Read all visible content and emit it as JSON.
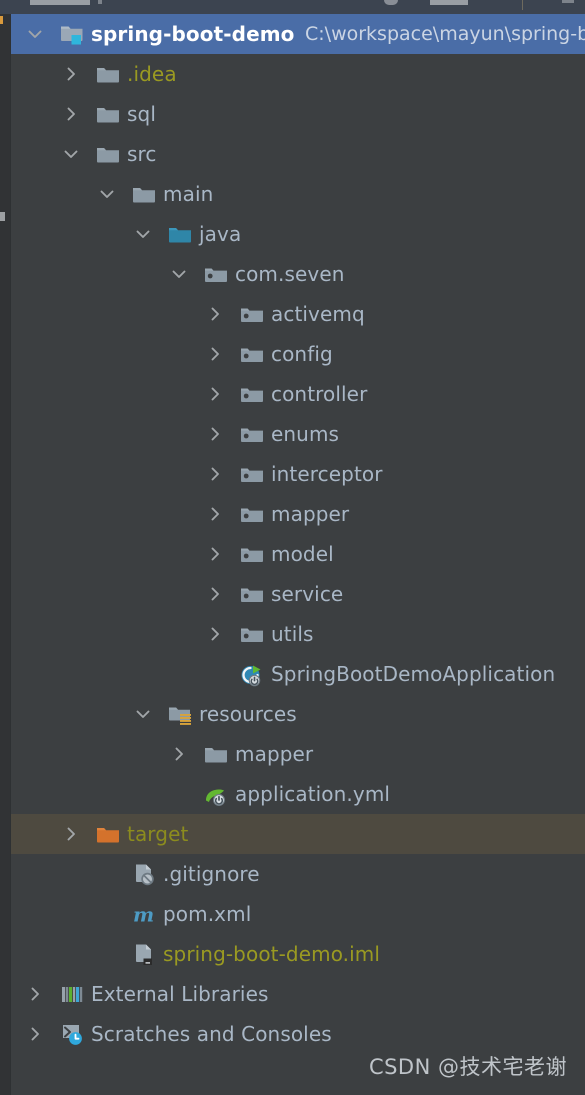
{
  "theme": {
    "background": "#3C3F41",
    "selection_background": "#4A6DA7",
    "hover_background": "#4E4A40",
    "text_default": "#A9B7C6",
    "text_excluded": "#9A9A22",
    "toolbar_background": "#3C4450",
    "gutter_background": "#313335"
  },
  "project_tree": {
    "rows": [
      {
        "label": "spring-boot-demo",
        "secondary": "C:\\workspace\\mayun\\spring-boot-",
        "icon": "module-icon",
        "arrow": "chevron-down-icon",
        "depth": 0,
        "state": "selected",
        "color": "#FFFFFF"
      },
      {
        "label": ".idea",
        "secondary": "",
        "icon": "folder-icon",
        "arrow": "chevron-right-icon",
        "depth": 1,
        "state": "normal",
        "color": "#9A9A22"
      },
      {
        "label": "sql",
        "secondary": "",
        "icon": "folder-icon",
        "arrow": "chevron-right-icon",
        "depth": 1,
        "state": "normal",
        "color": "#A9B7C6"
      },
      {
        "label": "src",
        "secondary": "",
        "icon": "folder-icon",
        "arrow": "chevron-down-icon",
        "depth": 1,
        "state": "normal",
        "color": "#A9B7C6"
      },
      {
        "label": "main",
        "secondary": "",
        "icon": "folder-icon",
        "arrow": "chevron-down-icon",
        "depth": 2,
        "state": "normal",
        "color": "#A9B7C6"
      },
      {
        "label": "java",
        "secondary": "",
        "icon": "source-root-folder-icon",
        "arrow": "chevron-down-icon",
        "depth": 3,
        "state": "normal",
        "color": "#A9B7C6"
      },
      {
        "label": "com.seven",
        "secondary": "",
        "icon": "package-icon",
        "arrow": "chevron-down-icon",
        "depth": 4,
        "state": "normal",
        "color": "#A9B7C6"
      },
      {
        "label": "activemq",
        "secondary": "",
        "icon": "package-icon",
        "arrow": "chevron-right-icon",
        "depth": 5,
        "state": "normal",
        "color": "#A9B7C6"
      },
      {
        "label": "config",
        "secondary": "",
        "icon": "package-icon",
        "arrow": "chevron-right-icon",
        "depth": 5,
        "state": "normal",
        "color": "#A9B7C6"
      },
      {
        "label": "controller",
        "secondary": "",
        "icon": "package-icon",
        "arrow": "chevron-right-icon",
        "depth": 5,
        "state": "normal",
        "color": "#A9B7C6"
      },
      {
        "label": "enums",
        "secondary": "",
        "icon": "package-icon",
        "arrow": "chevron-right-icon",
        "depth": 5,
        "state": "normal",
        "color": "#A9B7C6"
      },
      {
        "label": "interceptor",
        "secondary": "",
        "icon": "package-icon",
        "arrow": "chevron-right-icon",
        "depth": 5,
        "state": "normal",
        "color": "#A9B7C6"
      },
      {
        "label": "mapper",
        "secondary": "",
        "icon": "package-icon",
        "arrow": "chevron-right-icon",
        "depth": 5,
        "state": "normal",
        "color": "#A9B7C6"
      },
      {
        "label": "model",
        "secondary": "",
        "icon": "package-icon",
        "arrow": "chevron-right-icon",
        "depth": 5,
        "state": "normal",
        "color": "#A9B7C6"
      },
      {
        "label": "service",
        "secondary": "",
        "icon": "package-icon",
        "arrow": "chevron-right-icon",
        "depth": 5,
        "state": "normal",
        "color": "#A9B7C6"
      },
      {
        "label": "utils",
        "secondary": "",
        "icon": "package-icon",
        "arrow": "chevron-right-icon",
        "depth": 5,
        "state": "normal",
        "color": "#A9B7C6"
      },
      {
        "label": "SpringBootDemoApplication",
        "secondary": "",
        "icon": "spring-boot-class-icon",
        "arrow": "",
        "depth": 5,
        "state": "normal",
        "color": "#A9B7C6"
      },
      {
        "label": "resources",
        "secondary": "",
        "icon": "resource-root-folder-icon",
        "arrow": "chevron-down-icon",
        "depth": 3,
        "state": "normal",
        "color": "#A9B7C6"
      },
      {
        "label": "mapper",
        "secondary": "",
        "icon": "folder-icon",
        "arrow": "chevron-right-icon",
        "depth": 4,
        "state": "normal",
        "color": "#A9B7C6"
      },
      {
        "label": "application.yml",
        "secondary": "",
        "icon": "spring-yaml-icon",
        "arrow": "",
        "depth": 4,
        "state": "normal",
        "color": "#A9B7C6"
      },
      {
        "label": "target",
        "secondary": "",
        "icon": "excluded-folder-icon",
        "arrow": "chevron-right-icon",
        "depth": 1,
        "state": "hovered",
        "color": "#8C8C1E"
      },
      {
        "label": ".gitignore",
        "secondary": "",
        "icon": "gitignore-file-icon",
        "arrow": "",
        "depth": 2,
        "state": "normal",
        "color": "#A9B7C6"
      },
      {
        "label": "pom.xml",
        "secondary": "",
        "icon": "maven-pom-icon",
        "arrow": "",
        "depth": 2,
        "state": "normal",
        "color": "#A9B7C6"
      },
      {
        "label": "spring-boot-demo.iml",
        "secondary": "",
        "icon": "iml-module-file-icon",
        "arrow": "",
        "depth": 2,
        "state": "normal",
        "color": "#9A9A22"
      },
      {
        "label": "External Libraries",
        "secondary": "",
        "icon": "external-libraries-icon",
        "arrow": "chevron-right-icon",
        "depth": 0,
        "state": "normal",
        "color": "#A9B7C6"
      },
      {
        "label": "Scratches and Consoles",
        "secondary": "",
        "icon": "scratches-icon",
        "arrow": "chevron-right-icon",
        "depth": 0,
        "state": "normal",
        "color": "#A9B7C6"
      }
    ]
  },
  "watermark": {
    "text": "CSDN @技术宅老谢"
  }
}
